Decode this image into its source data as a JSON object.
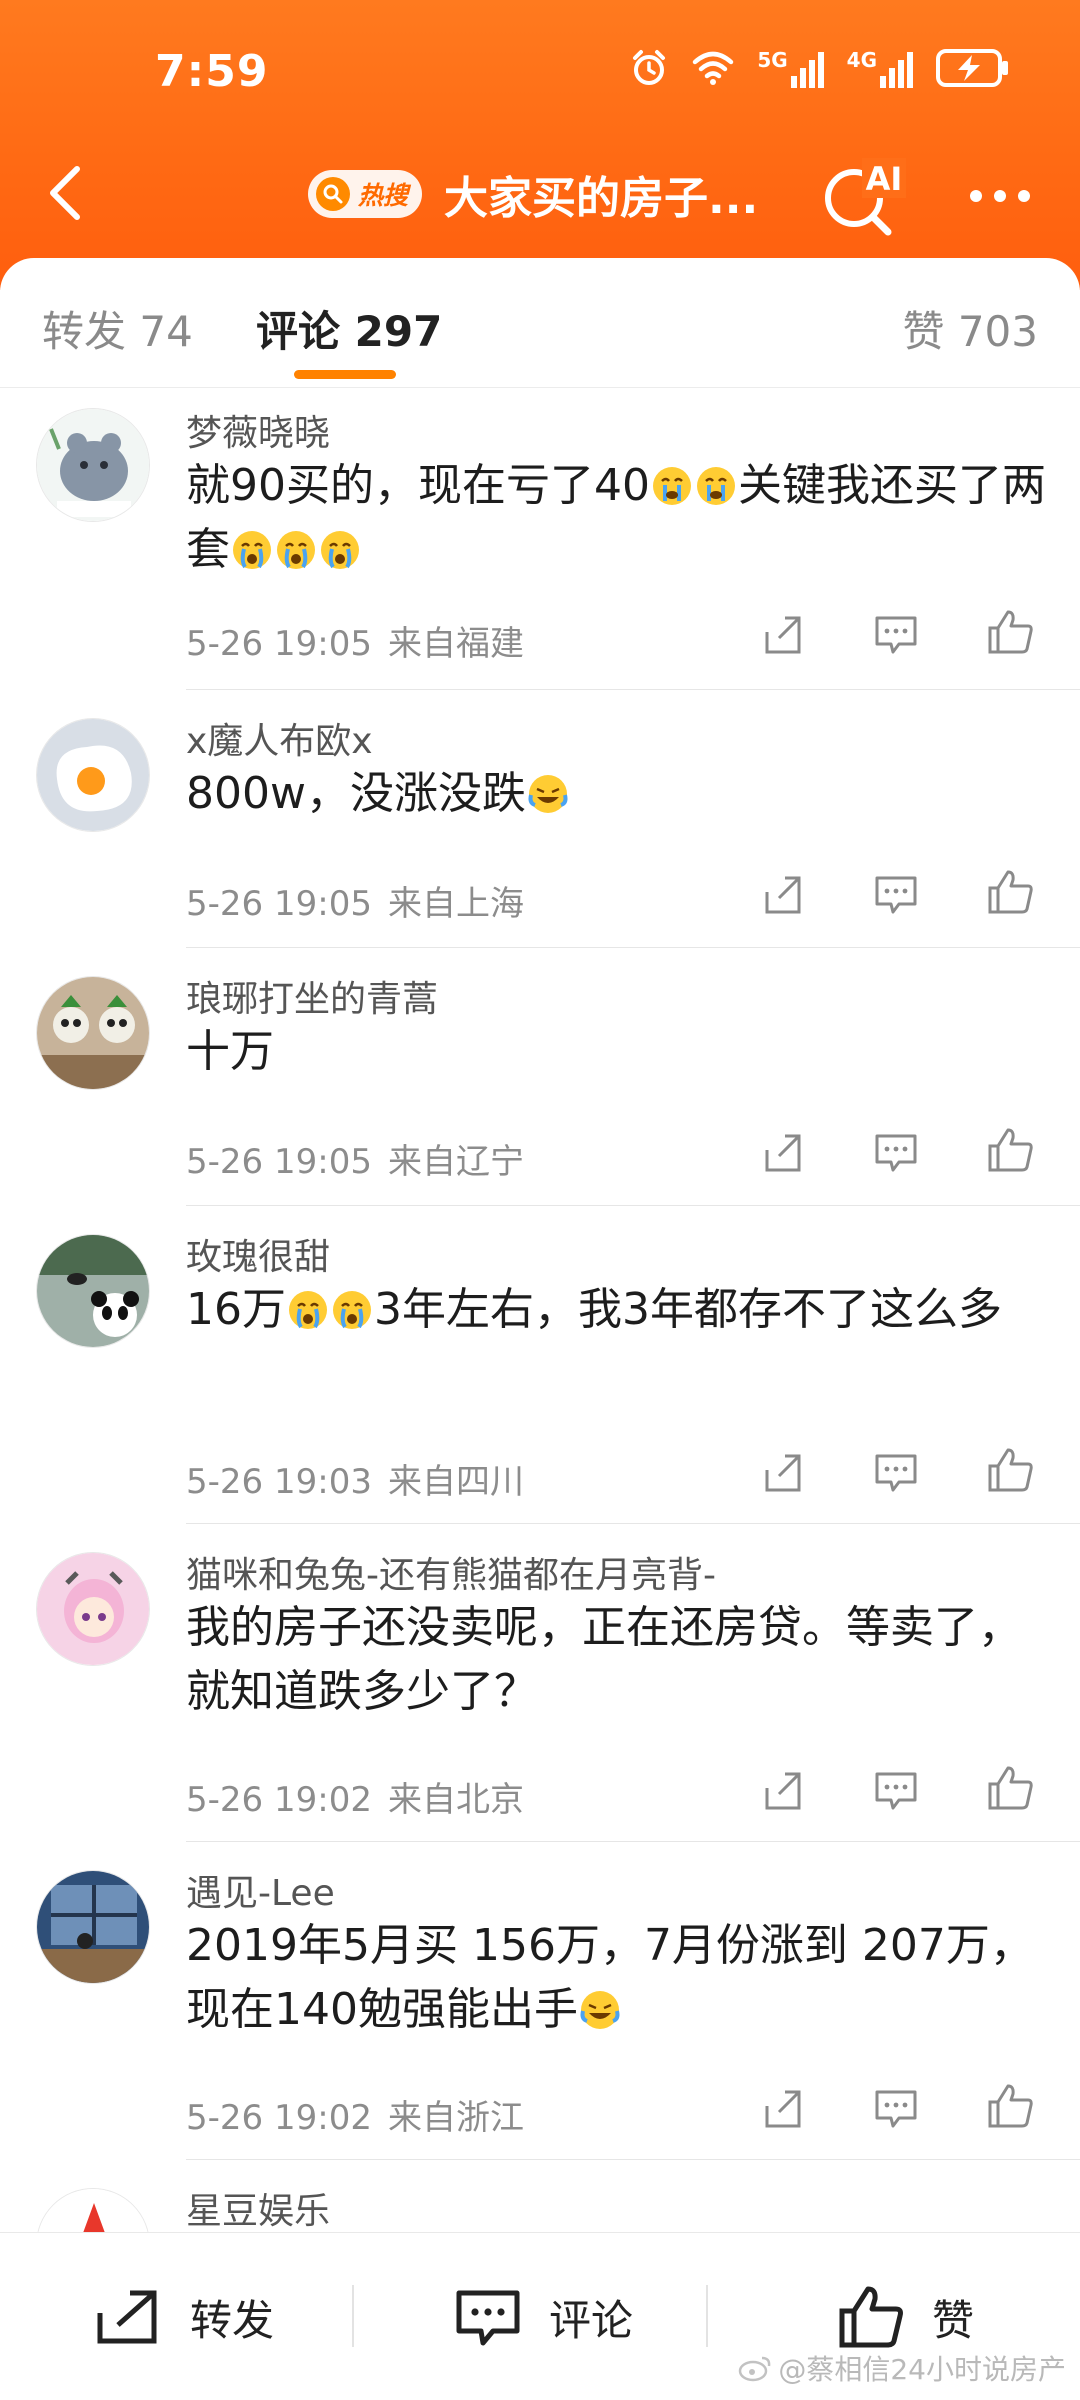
{
  "status_bar": {
    "time": "7:59",
    "net1": "5G",
    "net2": "4G"
  },
  "header": {
    "hot_badge": "热搜",
    "title": "大家买的房子...",
    "ai_label": "AI"
  },
  "tabs": {
    "reposts": "转发 74",
    "comments": "评论 297",
    "likes": "赞 703",
    "active": "comments"
  },
  "comments": [
    {
      "name": "梦薇晓晓",
      "text_parts": [
        "就90买的，现在亏了40",
        "关键我还买了两套"
      ],
      "date": "5-26 19:05",
      "location": "来自福建",
      "avatar": "cartoon-bear-avatar"
    },
    {
      "name": "x魔人布欧x",
      "text_parts": [
        "800w，没涨没跌"
      ],
      "date": "5-26 19:05",
      "location": "来自上海",
      "avatar": "fried-egg-avatar"
    },
    {
      "name": "琅琊打坐的青蒿",
      "text_parts": [
        "十万"
      ],
      "date": "5-26 19:05",
      "location": "来自辽宁",
      "avatar": "plush-figures-avatar"
    },
    {
      "name": "玫瑰很甜",
      "text_parts": [
        "16万",
        "3年左右，我3年都存不了这么多"
      ],
      "date": "5-26 19:03",
      "location": "来自四川",
      "avatar": "panda-pond-avatar"
    },
    {
      "name": "猫咪和兔兔-还有熊猫都在月亮背-",
      "text_parts": [
        "我的房子还没卖呢，正在还房贷。等卖了，就知道跌多少了？"
      ],
      "date": "5-26 19:02",
      "location": "来自北京",
      "avatar": "anime-girl-avatar"
    },
    {
      "name": "遇见-Lee",
      "text_parts": [
        "2019年5月买 156万，7月份涨到 207万，现在140勉强能出手"
      ],
      "date": "5-26 19:02",
      "location": "来自浙江",
      "avatar": "window-scene-avatar"
    },
    {
      "name": "星豆娱乐",
      "text_parts": [
        ""
      ],
      "date": "",
      "location": "",
      "avatar": "red-star-avatar"
    }
  ],
  "bottom_bar": {
    "repost": "转发",
    "comment": "评论",
    "like": "赞"
  },
  "watermark": "@蔡相信24小时说房产",
  "colors": {
    "header_orange": "#ff6a14",
    "accent": "#ff8200",
    "text_dark": "#1d1d1d",
    "meta_gray": "#8c8c8c"
  }
}
